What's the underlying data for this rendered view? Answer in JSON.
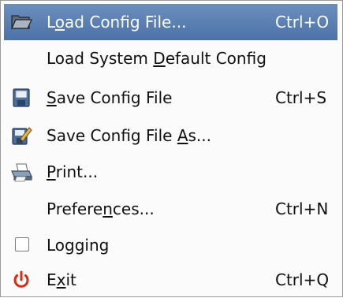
{
  "menu": {
    "items": [
      {
        "pre": "L",
        "mn": "o",
        "post": "ad Config File...",
        "shortcut": "Ctrl+O",
        "icon": "folder-open-icon",
        "highlighted": true
      },
      {
        "pre": "Load System ",
        "mn": "D",
        "post": "efault Config",
        "shortcut": "",
        "icon": ""
      },
      {
        "pre": "",
        "mn": "S",
        "post": "ave Config File",
        "shortcut": "Ctrl+S",
        "icon": "floppy-disk-icon"
      },
      {
        "pre": "Save Config File ",
        "mn": "A",
        "post": "s...",
        "shortcut": "",
        "icon": "save-as-icon"
      },
      {
        "pre": "",
        "mn": "P",
        "post": "rint...",
        "shortcut": "",
        "icon": "printer-icon"
      },
      {
        "pre": "Prefere",
        "mn": "n",
        "post": "ces...",
        "shortcut": "Ctrl+N",
        "icon": ""
      },
      {
        "pre": "",
        "mn": "",
        "post": "Logging",
        "shortcut": "",
        "icon": "checkbox",
        "checked": false
      },
      {
        "pre": "E",
        "mn": "x",
        "post": "it",
        "shortcut": "Ctrl+Q",
        "icon": "power-icon"
      }
    ]
  },
  "colors": {
    "highlight": "#5a7fb3",
    "power_icon": "#d92b12"
  }
}
